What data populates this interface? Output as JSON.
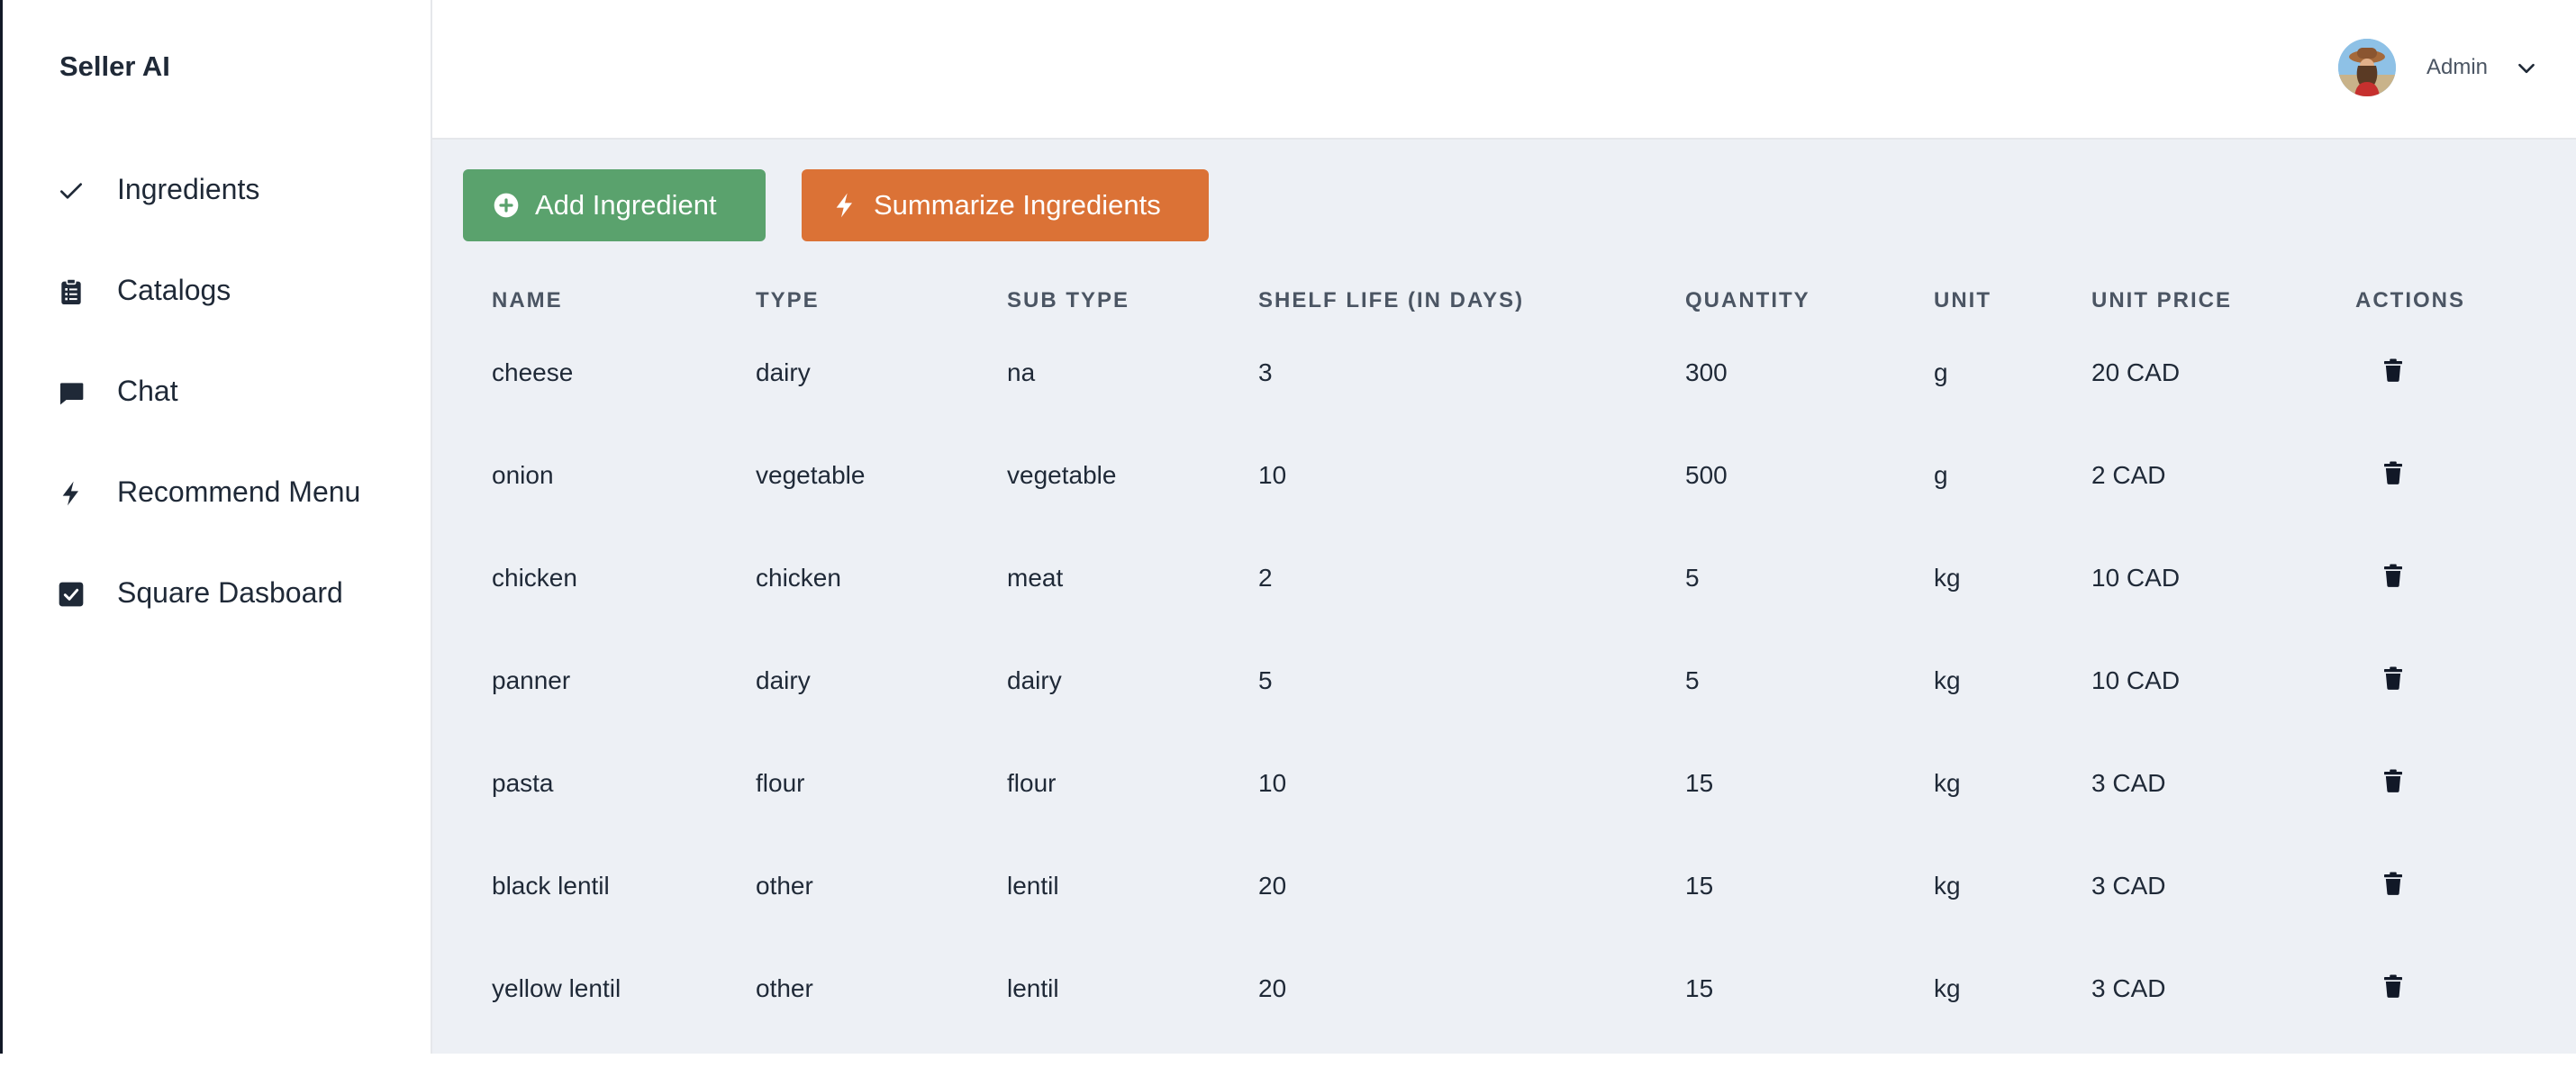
{
  "brand": "Seller AI",
  "sidebar": {
    "items": [
      {
        "label": "Ingredients",
        "icon": "check-icon"
      },
      {
        "label": "Catalogs",
        "icon": "clipboard-list-icon"
      },
      {
        "label": "Chat",
        "icon": "chat-bubble-icon"
      },
      {
        "label": "Recommend Menu",
        "icon": "lightning-bolt-icon"
      },
      {
        "label": "Square Dasboard",
        "icon": "checkbox-checked-icon"
      }
    ]
  },
  "header": {
    "user_name": "Admin",
    "avatar_icon": "user-avatar",
    "menu_icon": "chevron-down-icon"
  },
  "toolbar": {
    "add_label": "Add Ingredient",
    "add_icon": "plus-circle-icon",
    "add_color": "#5aa26d",
    "summarize_label": "Summarize Ingredients",
    "summarize_icon": "lightning-bolt-icon",
    "summarize_color": "#db7236"
  },
  "table": {
    "columns": [
      "NAME",
      "TYPE",
      "SUB TYPE",
      "SHELF LIFE (IN DAYS)",
      "QUANTITY",
      "UNIT",
      "UNIT PRICE",
      "ACTIONS"
    ],
    "rows": [
      {
        "name": "cheese",
        "type": "dairy",
        "sub_type": "na",
        "shelf_life": "3",
        "quantity": "300",
        "unit": "g",
        "unit_price": "20 CAD"
      },
      {
        "name": "onion",
        "type": "vegetable",
        "sub_type": "vegetable",
        "shelf_life": "10",
        "quantity": "500",
        "unit": "g",
        "unit_price": "2 CAD"
      },
      {
        "name": "chicken",
        "type": "chicken",
        "sub_type": "meat",
        "shelf_life": "2",
        "quantity": "5",
        "unit": "kg",
        "unit_price": "10 CAD"
      },
      {
        "name": "panner",
        "type": "dairy",
        "sub_type": "dairy",
        "shelf_life": "5",
        "quantity": "5",
        "unit": "kg",
        "unit_price": "10 CAD"
      },
      {
        "name": "pasta",
        "type": "flour",
        "sub_type": "flour",
        "shelf_life": "10",
        "quantity": "15",
        "unit": "kg",
        "unit_price": "3 CAD"
      },
      {
        "name": "black lentil",
        "type": "other",
        "sub_type": "lentil",
        "shelf_life": "20",
        "quantity": "15",
        "unit": "kg",
        "unit_price": "3 CAD"
      },
      {
        "name": "yellow lentil",
        "type": "other",
        "sub_type": "lentil",
        "shelf_life": "20",
        "quantity": "15",
        "unit": "kg",
        "unit_price": "3 CAD"
      }
    ],
    "action_icon": "trash-icon"
  }
}
